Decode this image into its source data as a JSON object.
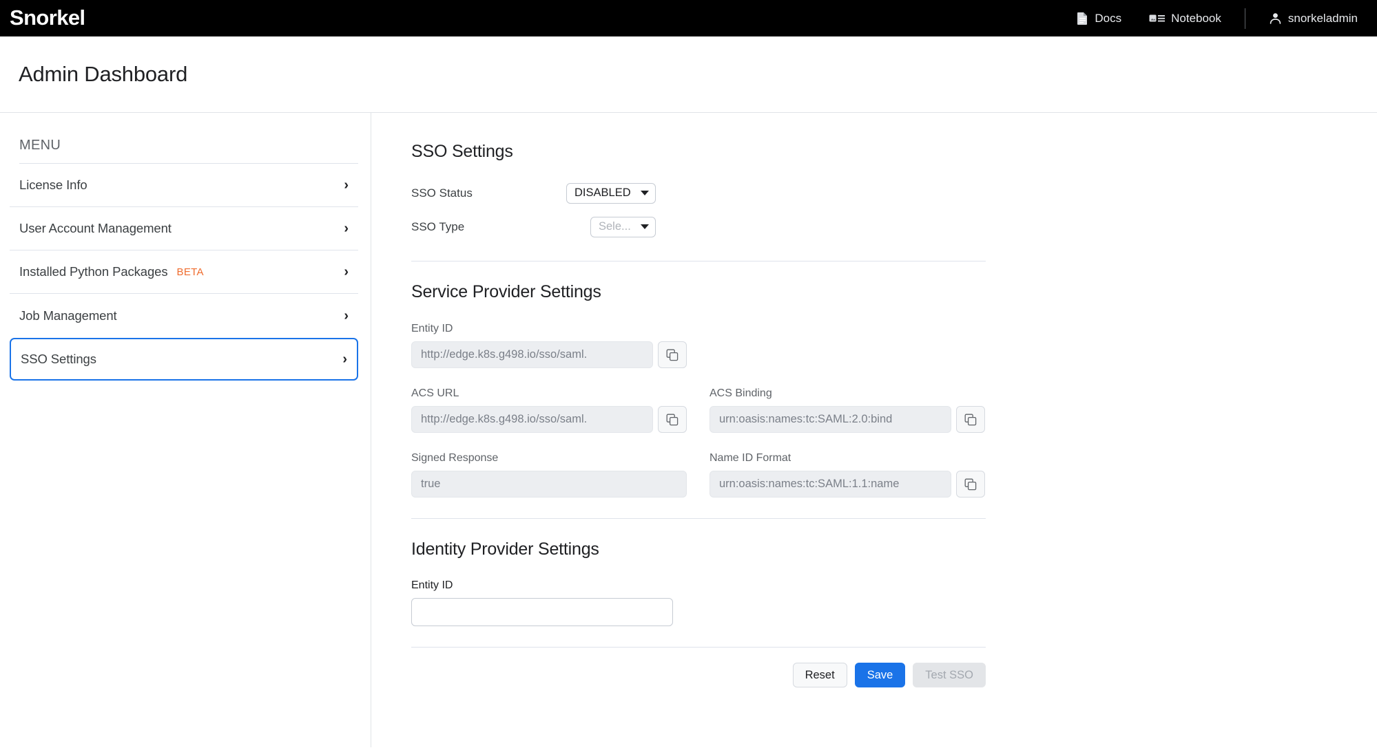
{
  "topbar": {
    "logo": "Snorkel",
    "logo_main": "Snorke",
    "logo_tail": "l",
    "nav": [
      {
        "label": "Docs",
        "icon": "document-icon"
      },
      {
        "label": "Notebook",
        "icon": "notebook-icon"
      }
    ],
    "user": {
      "label": "snorkeladmin",
      "icon": "person-icon"
    }
  },
  "header": {
    "title": "Admin Dashboard"
  },
  "sidebar": {
    "menu_label": "MENU",
    "items": [
      {
        "label": "License Info",
        "badge": "",
        "active": false
      },
      {
        "label": "User Account Management",
        "badge": "",
        "active": false
      },
      {
        "label": "Installed Python Packages",
        "badge": "BETA",
        "active": false
      },
      {
        "label": "Job Management",
        "badge": "",
        "active": false
      },
      {
        "label": "SSO Settings",
        "badge": "",
        "active": true
      }
    ],
    "chevron": "›"
  },
  "main": {
    "sso": {
      "title": "SSO Settings",
      "status_label": "SSO Status",
      "status_value": "DISABLED",
      "type_label": "SSO Type",
      "type_value": "Sele...",
      "type_placeholder": "Select..."
    },
    "service_provider": {
      "title": "Service Provider Settings",
      "entity_id_label": "Entity ID",
      "entity_id_value": "http://edge.k8s.g498.io/sso/saml.",
      "acs_url_label": "ACS URL",
      "acs_url_value": "http://edge.k8s.g498.io/sso/saml.",
      "acs_binding_label": "ACS Binding",
      "acs_binding_value": "urn:oasis:names:tc:SAML:2.0:bind",
      "signed_response_label": "Signed Response",
      "signed_response_value": "true",
      "name_id_format_label": "Name ID Format",
      "name_id_format_value": "urn:oasis:names:tc:SAML:1.1:name"
    },
    "identity_provider": {
      "title": "Identity Provider Settings",
      "entity_id_label": "Entity ID",
      "entity_id_value": "",
      "entity_id_placeholder": ""
    },
    "footer": {
      "reset_label": "Reset",
      "save_label": "Save",
      "test_label": "Test SSO"
    }
  },
  "colors": {
    "accent_blue": "#1a73e8",
    "beta_orange": "#ef6c2e",
    "topbar_black": "#000000",
    "disabled_grey": "#e3e5e8"
  }
}
